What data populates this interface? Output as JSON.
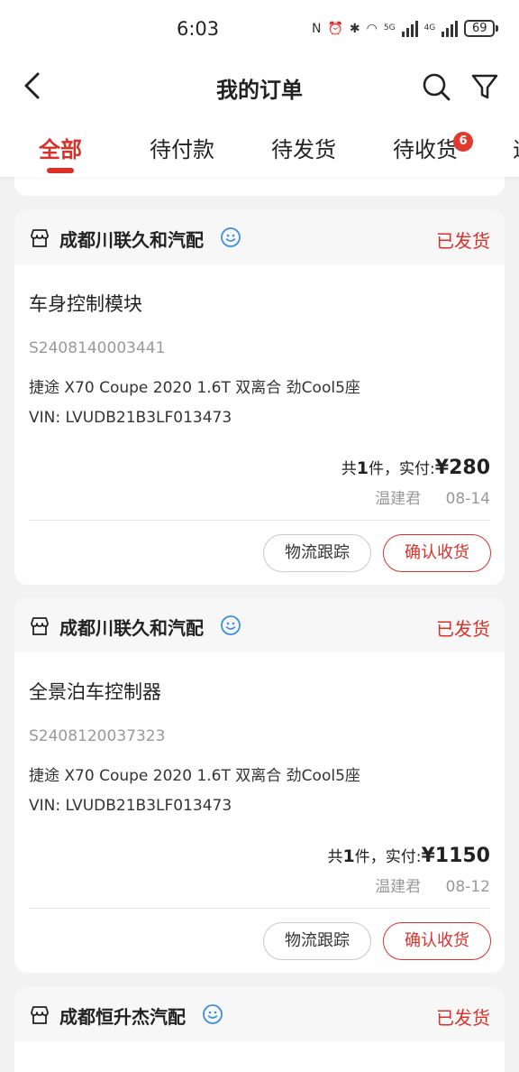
{
  "status_bar": {
    "time": "6:03",
    "network_1": "5G",
    "network_2": "4G",
    "battery": "69"
  },
  "header": {
    "title": "我的订单",
    "back_icon": "chevron-left-icon",
    "search_icon": "search-icon",
    "filter_icon": "filter-icon"
  },
  "tabs": [
    {
      "label": "全部",
      "active": true
    },
    {
      "label": "待付款",
      "active": false
    },
    {
      "label": "待发货",
      "active": false
    },
    {
      "label": "待收货",
      "active": false,
      "badge": "6"
    },
    {
      "label": "退",
      "active": false
    }
  ],
  "orders": [
    {
      "shop": "成都川联久和汽配",
      "status": "已发货",
      "product": "车身控制模块",
      "order_no": "S2408140003441",
      "vehicle": "捷途 X70 Coupe 2020 1.6T 双离合 劲Cool5座",
      "vin_label": "VIN:",
      "vin": "LVUDB21B3LF013473",
      "count_prefix": "共",
      "count": "1",
      "count_suffix": "件，实付: ",
      "price": "¥280",
      "buyer": "温建君",
      "date": "08-14",
      "btn_logistics": "物流跟踪",
      "btn_confirm": "确认收货"
    },
    {
      "shop": "成都川联久和汽配",
      "status": "已发货",
      "product": "全景泊车控制器",
      "order_no": "S2408120037323",
      "vehicle": "捷途 X70 Coupe 2020 1.6T 双离合 劲Cool5座",
      "vin_label": "VIN:",
      "vin": "LVUDB21B3LF013473",
      "count_prefix": "共",
      "count": "1",
      "count_suffix": "件，实付: ",
      "price": "¥1150",
      "buyer": "温建君",
      "date": "08-12",
      "btn_logistics": "物流跟踪",
      "btn_confirm": "确认收货"
    },
    {
      "shop": "成都恒升杰汽配",
      "status": "已发货"
    }
  ],
  "colors": {
    "accent": "#d9312a",
    "background": "#f2f2f2",
    "card": "#ffffff",
    "muted_text": "#999999"
  }
}
